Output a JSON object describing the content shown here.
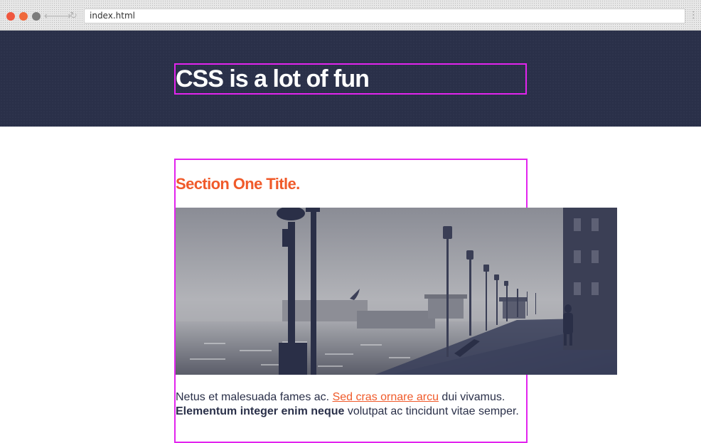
{
  "browser": {
    "address": "index.html",
    "back_glyph": "⟵",
    "forward_glyph": "⟶",
    "reload_glyph": "↻",
    "menu_glyph": "⋮",
    "icons": [
      "back-arrow-icon",
      "forward-arrow-icon",
      "reload-icon",
      "menu-icon"
    ]
  },
  "header": {
    "title": "CSS is a lot of fun",
    "background_color": "#2a3049",
    "outline_color": "#e224ee"
  },
  "section": {
    "title": "Section One Title.",
    "title_color": "#f05a2a",
    "paragraph": {
      "text_before_link": "Netus et malesuada fames ac. ",
      "link": "Sed cras ornare arcu",
      "text_after_link": " dui vivamus. ",
      "bold": "Elementum integer enim neque",
      "text_end": " volutpat ac tincidunt vitae semper."
    }
  }
}
